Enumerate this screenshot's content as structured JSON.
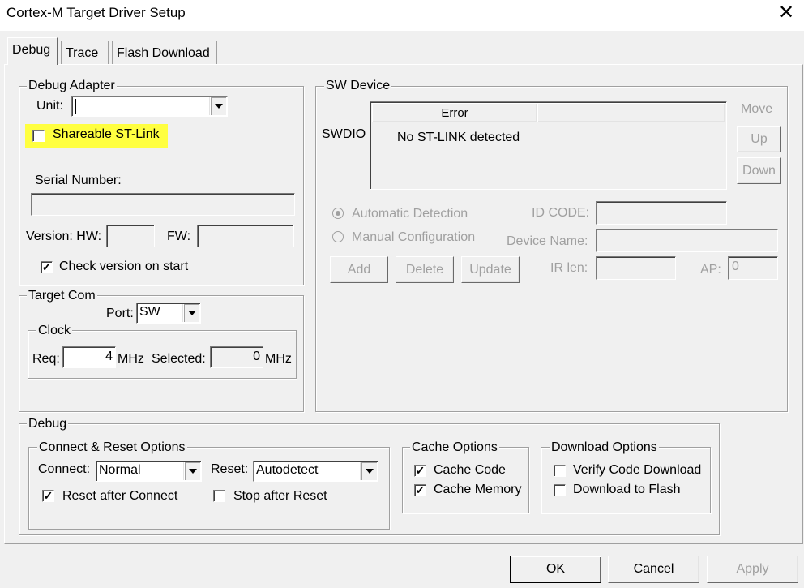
{
  "window": {
    "title": "Cortex-M Target Driver Setup"
  },
  "tabs": [
    {
      "label": "Debug"
    },
    {
      "label": "Trace"
    },
    {
      "label": "Flash Download"
    }
  ],
  "debug_adapter": {
    "title": "Debug Adapter",
    "unit_label": "Unit:",
    "unit_value": "",
    "shareable_label": "Shareable ST-Link",
    "serial_label": "Serial Number:",
    "serial_value": "",
    "version_label": "Version: HW:",
    "fw_label": "FW:",
    "check_version_label": "Check version on start"
  },
  "target_com": {
    "title": "Target Com",
    "port_label": "Port:",
    "port_value": "SW",
    "clock_title": "Clock",
    "req_label": "Req:",
    "req_value": "4",
    "req_unit": "MHz",
    "selected_label": "Selected:",
    "selected_value": "0",
    "selected_unit": "MHz"
  },
  "sw_device": {
    "title": "SW Device",
    "swdio_label": "SWDIO",
    "col_error": "Error",
    "col_2": "",
    "row_message": "No ST-LINK detected",
    "move_label": "Move",
    "up_label": "Up",
    "down_label": "Down",
    "auto_detect_label": "Automatic Detection",
    "manual_config_label": "Manual Configuration",
    "id_code_label": "ID CODE:",
    "device_name_label": "Device Name:",
    "ir_len_label": "IR len:",
    "ap_label": "AP:",
    "ap_value": "0",
    "add_label": "Add",
    "delete_label": "Delete",
    "update_label": "Update"
  },
  "debug": {
    "title": "Debug",
    "connect_reset_title": "Connect & Reset Options",
    "connect_label": "Connect:",
    "connect_value": "Normal",
    "reset_label": "Reset:",
    "reset_value": "Autodetect",
    "reset_after_connect_label": "Reset after Connect",
    "stop_after_reset_label": "Stop after Reset",
    "cache_title": "Cache Options",
    "cache_code_label": "Cache Code",
    "cache_memory_label": "Cache Memory",
    "download_title": "Download Options",
    "verify_label": "Verify Code Download",
    "download_flash_label": "Download to Flash"
  },
  "footer": {
    "ok": "OK",
    "cancel": "Cancel",
    "apply": "Apply"
  },
  "colors": {
    "highlight": "#ffff40",
    "disabled_text": "#a0a0a0"
  }
}
